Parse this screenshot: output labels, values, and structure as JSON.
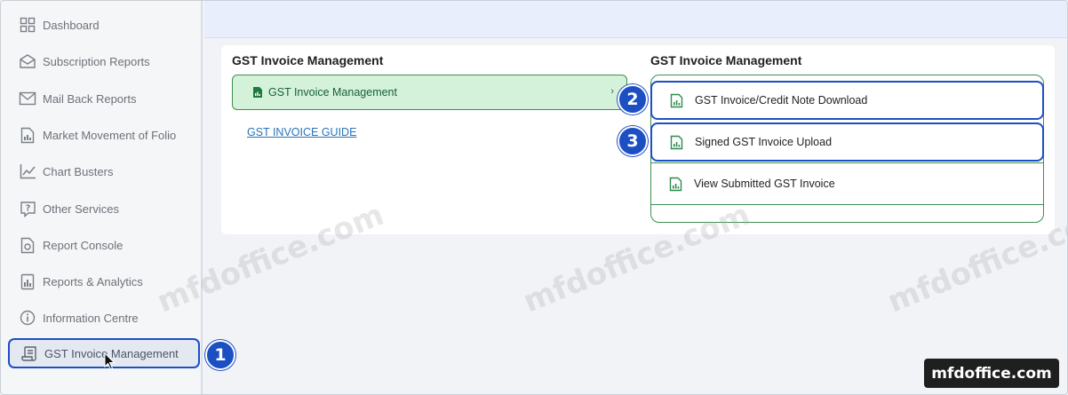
{
  "sidebar": {
    "items": [
      {
        "label": "Dashboard",
        "icon": "grid-icon"
      },
      {
        "label": "Subscription Reports",
        "icon": "envelope-open-icon"
      },
      {
        "label": "Mail Back Reports",
        "icon": "mail-icon"
      },
      {
        "label": "Market Movement of Folio",
        "icon": "document-chart-icon"
      },
      {
        "label": "Chart Busters",
        "icon": "line-chart-icon"
      },
      {
        "label": "Other Services",
        "icon": "question-icon"
      },
      {
        "label": "Report Console",
        "icon": "report-console-icon"
      },
      {
        "label": "Reports & Analytics",
        "icon": "report-analytics-icon"
      },
      {
        "label": "Information Centre",
        "icon": "info-icon"
      },
      {
        "label": "GST Invoice Management",
        "icon": "scroll-icon",
        "active": true
      }
    ]
  },
  "steps": {
    "one": "1",
    "two": "2",
    "three": "3"
  },
  "left_panel": {
    "title": "GST Invoice Management",
    "menu_item": "GST Invoice Management",
    "guide_link": "GST INVOICE GUIDE"
  },
  "right_panel": {
    "title": "GST Invoice Management",
    "items": [
      {
        "label": "GST Invoice/Credit Note Download"
      },
      {
        "label": "Signed GST Invoice Upload"
      },
      {
        "label": "View Submitted GST Invoice"
      }
    ]
  },
  "watermark": "mfdoffice.com",
  "brand": "mfdoffice.com",
  "colors": {
    "accent": "#1d4fc4",
    "green": "#3e8f52",
    "green_bg": "#d4f2d9"
  }
}
